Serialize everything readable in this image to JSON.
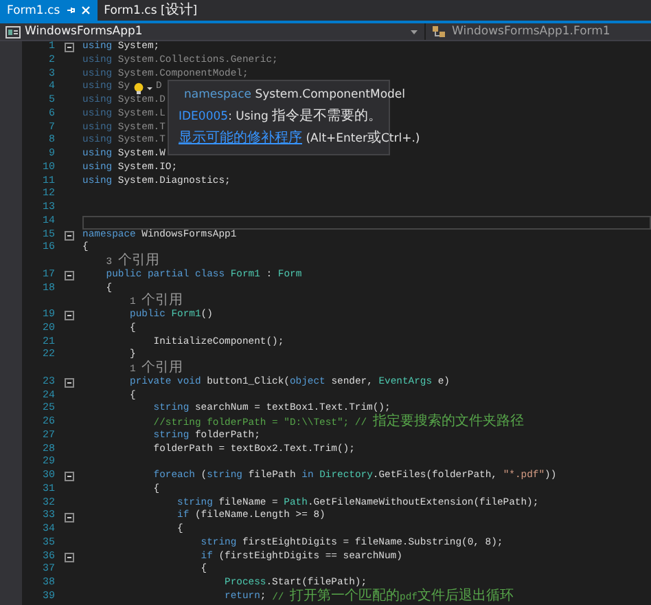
{
  "tabs": [
    {
      "label": "Form1.cs",
      "selected": true
    },
    {
      "label": "Form1.cs [设计]",
      "selected": false
    }
  ],
  "navigation": {
    "project": "WindowsFormsApp1",
    "type": "WindowsFormsApp1.Form1"
  },
  "editor": {
    "lines": [
      {
        "number": "1",
        "fold": true,
        "faded": false,
        "current": false,
        "tokens": [
          {
            "kind": "keyword",
            "text": "using"
          },
          {
            "kind": "plain",
            "text": " System;"
          }
        ]
      },
      {
        "number": "2",
        "fold": false,
        "faded": true,
        "current": false,
        "tokens": [
          {
            "kind": "keyword",
            "text": "using"
          },
          {
            "kind": "plain",
            "text": " System.Collections.Generic;"
          }
        ]
      },
      {
        "number": "3",
        "fold": false,
        "faded": true,
        "current": false,
        "tokens": [
          {
            "kind": "keyword",
            "text": "using"
          },
          {
            "kind": "plain",
            "text": " System.ComponentModel;"
          }
        ]
      },
      {
        "number": "4",
        "fold": false,
        "faded": true,
        "current": false,
        "tokens": [
          {
            "kind": "keyword",
            "text": "using"
          },
          {
            "kind": "plain",
            "text": " Sy"
          },
          {
            "kind": "lightbulb"
          },
          {
            "kind": "plain",
            "text": "D"
          }
        ]
      },
      {
        "number": "5",
        "fold": false,
        "faded": true,
        "current": false,
        "tokens": [
          {
            "kind": "keyword",
            "text": "using"
          },
          {
            "kind": "plain",
            "text": " System.D"
          }
        ]
      },
      {
        "number": "6",
        "fold": false,
        "faded": true,
        "current": false,
        "tokens": [
          {
            "kind": "keyword",
            "text": "using"
          },
          {
            "kind": "plain",
            "text": " System.L"
          }
        ]
      },
      {
        "number": "7",
        "fold": false,
        "faded": true,
        "current": false,
        "tokens": [
          {
            "kind": "keyword",
            "text": "using"
          },
          {
            "kind": "plain",
            "text": " System.T"
          }
        ]
      },
      {
        "number": "8",
        "fold": false,
        "faded": true,
        "current": false,
        "tokens": [
          {
            "kind": "keyword",
            "text": "using"
          },
          {
            "kind": "plain",
            "text": " System.T"
          }
        ]
      },
      {
        "number": "9",
        "fold": false,
        "faded": false,
        "current": false,
        "tokens": [
          {
            "kind": "keyword",
            "text": "using"
          },
          {
            "kind": "plain",
            "text": " System.W"
          }
        ]
      },
      {
        "number": "10",
        "fold": false,
        "faded": false,
        "current": false,
        "tokens": [
          {
            "kind": "keyword",
            "text": "using"
          },
          {
            "kind": "plain",
            "text": " System.IO;"
          }
        ]
      },
      {
        "number": "11",
        "fold": false,
        "faded": false,
        "current": false,
        "tokens": [
          {
            "kind": "keyword",
            "text": "using"
          },
          {
            "kind": "plain",
            "text": " System.Diagnostics;"
          }
        ]
      },
      {
        "number": "12",
        "fold": false,
        "current": false
      },
      {
        "number": "13",
        "fold": false,
        "current": false
      },
      {
        "number": "14",
        "fold": false,
        "current": true
      },
      {
        "number": "15",
        "fold": true,
        "faded": false,
        "current": false,
        "tokens": [
          {
            "kind": "keyword",
            "text": "namespace"
          },
          {
            "kind": "plain",
            "text": " WindowsFormsApp1"
          }
        ]
      },
      {
        "number": "16",
        "fold": false,
        "faded": false,
        "current": false,
        "tokens": [
          {
            "kind": "plain",
            "text": "{"
          }
        ]
      },
      {
        "number": "17",
        "fold": true,
        "faded": false,
        "current": false,
        "codelens": "    3 个引用",
        "tokens": [
          {
            "kind": "keyword",
            "text": "    public partial class"
          },
          {
            "kind": "type",
            "text": " Form1"
          },
          {
            "kind": "plain",
            "text": " : "
          },
          {
            "kind": "type",
            "text": "Form"
          }
        ]
      },
      {
        "number": "18",
        "fold": false,
        "faded": false,
        "current": false,
        "tokens": [
          {
            "kind": "plain",
            "text": "    {"
          }
        ]
      },
      {
        "number": "19",
        "fold": true,
        "faded": false,
        "current": false,
        "codelens": "        1 个引用",
        "tokens": [
          {
            "kind": "keyword",
            "text": "        public"
          },
          {
            "kind": "type",
            "text": " Form1"
          },
          {
            "kind": "plain",
            "text": "()"
          }
        ]
      },
      {
        "number": "20",
        "fold": false,
        "faded": false,
        "current": false,
        "tokens": [
          {
            "kind": "plain",
            "text": "        {"
          }
        ]
      },
      {
        "number": "21",
        "fold": false,
        "faded": false,
        "current": false,
        "tokens": [
          {
            "kind": "plain",
            "text": "            InitializeComponent();"
          }
        ]
      },
      {
        "number": "22",
        "fold": false,
        "faded": false,
        "current": false,
        "tokens": [
          {
            "kind": "plain",
            "text": "        }"
          }
        ]
      },
      {
        "number": "23",
        "fold": true,
        "faded": false,
        "current": false,
        "codelens": "        1 个引用",
        "tokens": [
          {
            "kind": "keyword",
            "text": "        private void"
          },
          {
            "kind": "plain",
            "text": " button1_Click("
          },
          {
            "kind": "keyword",
            "text": "object"
          },
          {
            "kind": "plain",
            "text": " sender, "
          },
          {
            "kind": "type",
            "text": "EventArgs"
          },
          {
            "kind": "plain",
            "text": " e)"
          }
        ]
      },
      {
        "number": "24",
        "fold": false,
        "faded": false,
        "current": false,
        "tokens": [
          {
            "kind": "plain",
            "text": "        {"
          }
        ]
      },
      {
        "number": "25",
        "fold": false,
        "faded": false,
        "current": false,
        "tokens": [
          {
            "kind": "keyword",
            "text": "            string"
          },
          {
            "kind": "plain",
            "text": " searchNum = textBox1.Text.Trim();"
          }
        ]
      },
      {
        "number": "26",
        "fold": false,
        "faded": false,
        "current": false,
        "tokens": [
          {
            "kind": "comment",
            "text": "            //string folderPath = \"D:\\\\Test\"; // 指定要搜索的文件夹路径"
          }
        ]
      },
      {
        "number": "27",
        "fold": false,
        "faded": false,
        "current": false,
        "tokens": [
          {
            "kind": "keyword",
            "text": "            string"
          },
          {
            "kind": "plain",
            "text": " folderPath;"
          }
        ]
      },
      {
        "number": "28",
        "fold": false,
        "faded": false,
        "current": false,
        "tokens": [
          {
            "kind": "plain",
            "text": "            folderPath = textBox2.Text.Trim();"
          }
        ]
      },
      {
        "number": "29",
        "fold": false,
        "current": false
      },
      {
        "number": "30",
        "fold": true,
        "faded": false,
        "current": false,
        "tokens": [
          {
            "kind": "keyword",
            "text": "            foreach"
          },
          {
            "kind": "plain",
            "text": " ("
          },
          {
            "kind": "keyword",
            "text": "string"
          },
          {
            "kind": "plain",
            "text": " filePath "
          },
          {
            "kind": "keyword",
            "text": "in"
          },
          {
            "kind": "type",
            "text": " Directory"
          },
          {
            "kind": "plain",
            "text": ".GetFiles(folderPath, "
          },
          {
            "kind": "string",
            "text": "\"*.pdf\""
          },
          {
            "kind": "plain",
            "text": "))"
          }
        ]
      },
      {
        "number": "31",
        "fold": false,
        "faded": false,
        "current": false,
        "tokens": [
          {
            "kind": "plain",
            "text": "            {"
          }
        ]
      },
      {
        "number": "32",
        "fold": false,
        "faded": false,
        "current": false,
        "tokens": [
          {
            "kind": "keyword",
            "text": "                string"
          },
          {
            "kind": "plain",
            "text": " fileName = "
          },
          {
            "kind": "type",
            "text": "Path"
          },
          {
            "kind": "plain",
            "text": ".GetFileNameWithoutExtension(filePath);"
          }
        ]
      },
      {
        "number": "33",
        "fold": true,
        "faded": false,
        "current": false,
        "tokens": [
          {
            "kind": "keyword",
            "text": "                if"
          },
          {
            "kind": "plain",
            "text": " (fileName.Length >= 8)"
          }
        ]
      },
      {
        "number": "34",
        "fold": false,
        "faded": false,
        "current": false,
        "tokens": [
          {
            "kind": "plain",
            "text": "                {"
          }
        ]
      },
      {
        "number": "35",
        "fold": false,
        "faded": false,
        "current": false,
        "tokens": [
          {
            "kind": "keyword",
            "text": "                    string"
          },
          {
            "kind": "plain",
            "text": " firstEightDigits = fileName.Substring(0, 8);"
          }
        ]
      },
      {
        "number": "36",
        "fold": true,
        "faded": false,
        "current": false,
        "tokens": [
          {
            "kind": "keyword",
            "text": "                    if"
          },
          {
            "kind": "plain",
            "text": " (firstEightDigits == searchNum)"
          }
        ]
      },
      {
        "number": "37",
        "fold": false,
        "faded": false,
        "current": false,
        "tokens": [
          {
            "kind": "plain",
            "text": "                    {"
          }
        ]
      },
      {
        "number": "38",
        "fold": false,
        "faded": false,
        "current": false,
        "tokens": [
          {
            "kind": "type",
            "text": "                        Process"
          },
          {
            "kind": "plain",
            "text": ".Start(filePath);"
          }
        ]
      },
      {
        "number": "39",
        "fold": false,
        "faded": false,
        "current": false,
        "tokens": [
          {
            "kind": "keyword",
            "text": "                        return"
          },
          {
            "kind": "plain",
            "text": "; "
          },
          {
            "kind": "comment",
            "text": "// 打开第一个匹配的pdf文件后退出循环"
          }
        ]
      }
    ]
  },
  "quick_info": {
    "kind_label": "namespace",
    "name": " System.ComponentModel",
    "diagnostic_id": "IDE0005",
    "diagnostic_text": ": Using 指令是不需要的。",
    "fix_link": "显示可能的修补程序",
    "shortcut": " (Alt+Enter或Ctrl+.)"
  }
}
